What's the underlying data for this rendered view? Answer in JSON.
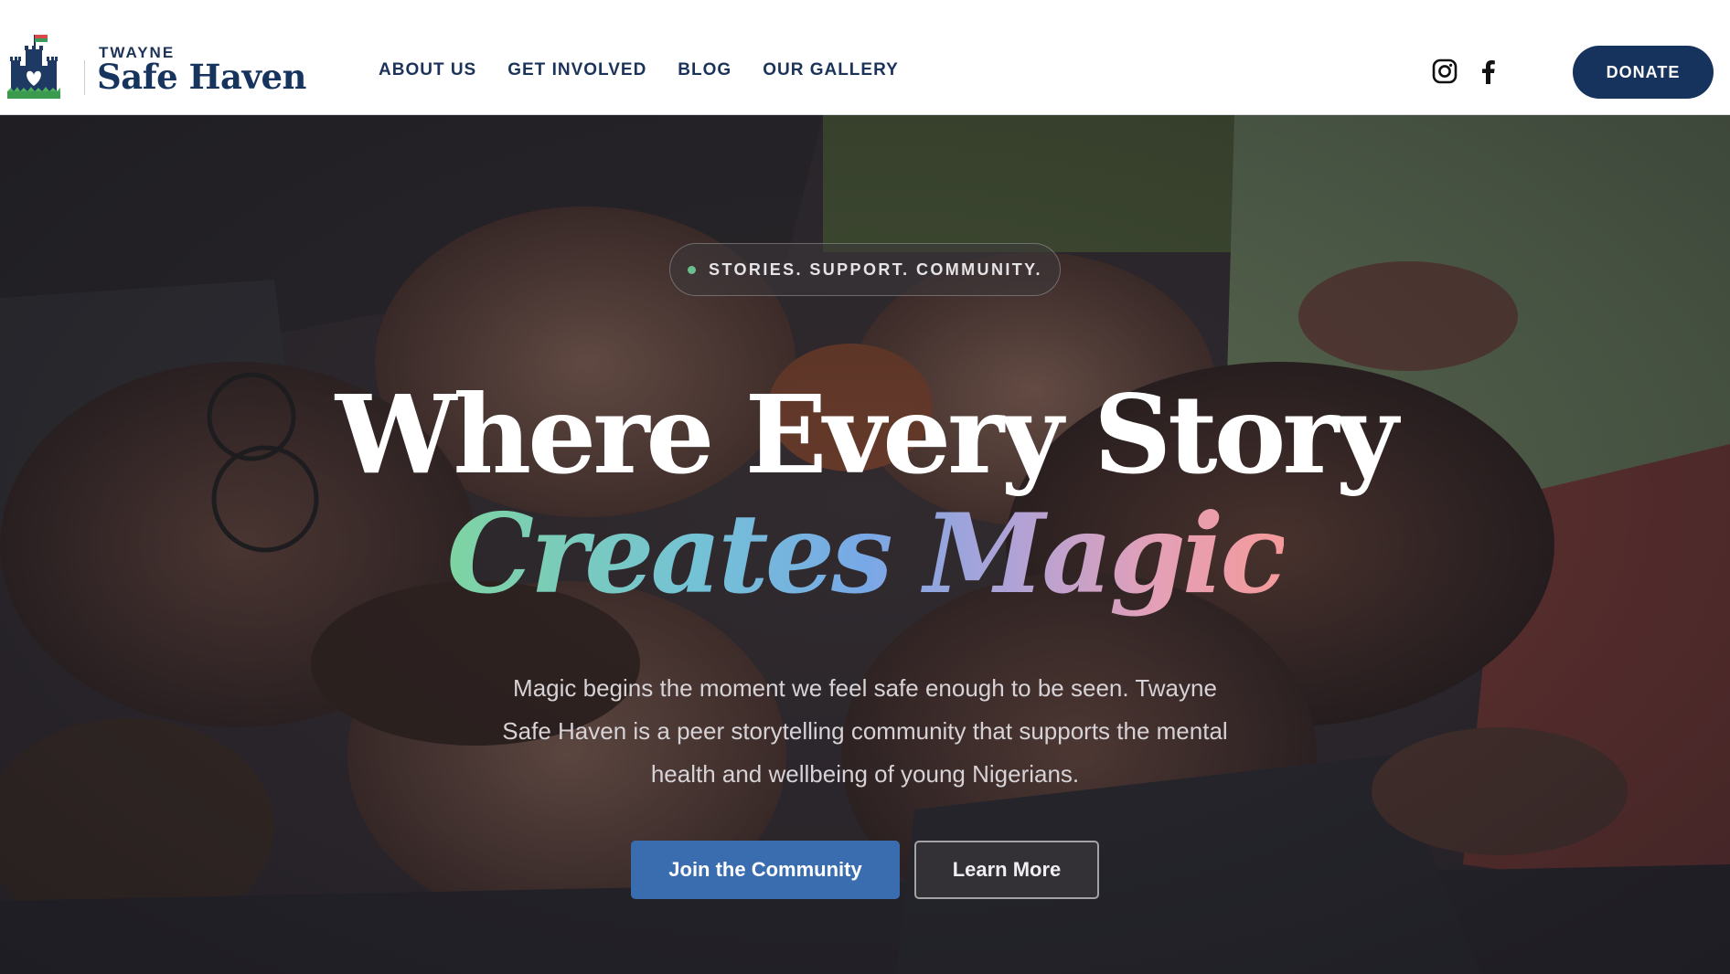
{
  "header": {
    "logo_eyebrow": "TWAYNE",
    "logo_name": "Safe Haven",
    "nav": [
      {
        "label": "ABOUT US"
      },
      {
        "label": "GET INVOLVED"
      },
      {
        "label": "BLOG"
      },
      {
        "label": "OUR GALLERY"
      }
    ],
    "social": [
      {
        "icon": "instagram-icon"
      },
      {
        "icon": "facebook-icon"
      }
    ],
    "donate_label": "DONATE"
  },
  "hero": {
    "tagline": "STORIES. SUPPORT. COMMUNITY.",
    "headline_line1": "Where Every Story",
    "headline_line2": "Creates Magic",
    "description": "Magic begins the moment we feel safe enough to be seen. Twayne Safe Haven is a peer storytelling community that supports the mental health and wellbeing of young Nigerians.",
    "primary_cta": "Join the Community",
    "secondary_cta": "Learn More",
    "background_image": "group-of-young-people-lying-on-grass-laughing-photo"
  },
  "colors": {
    "brand_navy": "#16335e",
    "primary_button": "#3a6db0",
    "gradient": [
      "#7fd4a2",
      "#78a8e6",
      "#f49a9a"
    ]
  }
}
